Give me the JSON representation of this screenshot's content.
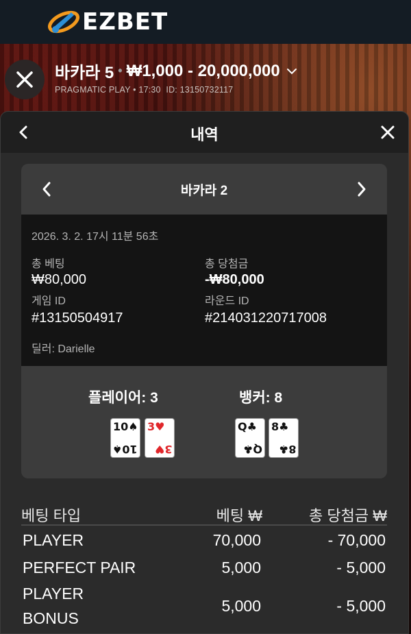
{
  "brand": {
    "name": "EZBET"
  },
  "header": {
    "title": "바카라 5",
    "separator": "•",
    "limits": "₩1,000 - 20,000,000",
    "provider": "PRAGMATIC PLAY",
    "sub_dot": "•",
    "time": "17:30",
    "id_text": "ID: 13150732117"
  },
  "panel": {
    "title": "내역"
  },
  "round": {
    "game_name": "바카라 2",
    "datetime": "2026. 3. 2. 17시 11분 56초",
    "total_bet_label": "총 베팅",
    "total_bet_value": "₩80,000",
    "total_win_label": "총 당첨금",
    "total_win_value": "-₩80,000",
    "game_id_label": "게임 ID",
    "game_id_value": "#13150504917",
    "round_id_label": "라운드 ID",
    "round_id_value": "#214031220717008",
    "dealer": "딜러: Darielle",
    "player_label": "플레이어: 3",
    "banker_label": "뱅커: 8",
    "player_cards": [
      {
        "rank": "10",
        "suit": "♠",
        "color": "black"
      },
      {
        "rank": "3",
        "suit": "♥",
        "color": "red"
      }
    ],
    "banker_cards": [
      {
        "rank": "Q",
        "suit": "♣",
        "color": "black"
      },
      {
        "rank": "8",
        "suit": "♣",
        "color": "black"
      }
    ]
  },
  "table": {
    "headers": [
      "베팅 타입",
      "베팅 ₩",
      "총 당첨금 ₩"
    ],
    "rows": [
      {
        "type": "PLAYER",
        "bet": "70,000",
        "win": "- 70,000"
      },
      {
        "type": "PERFECT PAIR",
        "bet": "5,000",
        "win": "- 5,000"
      },
      {
        "type_line1": "PLAYER",
        "type_line2": "BONUS",
        "bet": "5,000",
        "win": "- 5,000"
      }
    ]
  },
  "colors": {
    "panel_bg": "#2b2b2b",
    "card_bg": "#3c3c3c",
    "detail_bg": "#141414",
    "red_suit": "#e0262a"
  }
}
